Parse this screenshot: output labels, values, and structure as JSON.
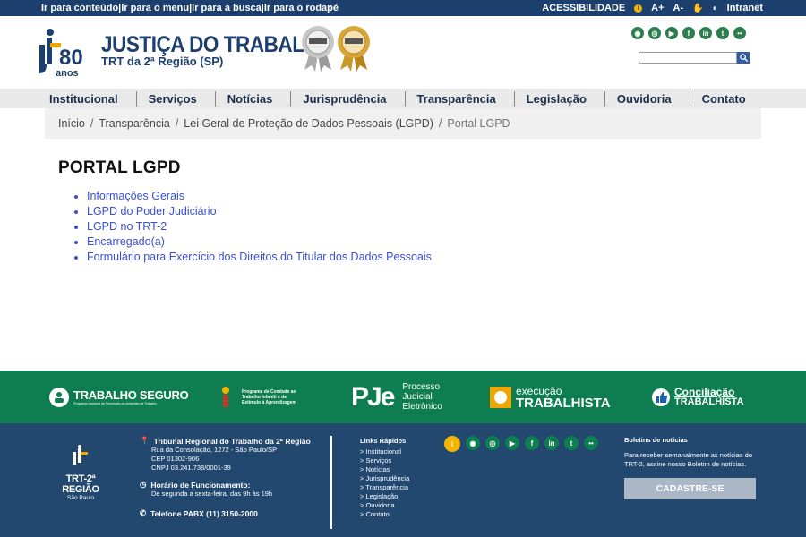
{
  "topbar": {
    "skip_links": [
      "Ir para conteúdo|",
      " Ir para o menu|",
      " Ir para a busca|",
      " Ir para o rodapé"
    ],
    "acessibilidade": "ACESSIBILIDADE",
    "font_up": "A+",
    "font_down": "A-",
    "intranet": "Intranet"
  },
  "header": {
    "logo_number": "80",
    "logo_anos": "anos",
    "brand_title": "JUSTIÇA DO TRABALHO",
    "brand_subtitle": "TRT da 2ª Região (SP)",
    "social_icons": [
      "rss-icon",
      "instagram-icon",
      "youtube-icon",
      "facebook-icon",
      "linkedin-icon",
      "twitter-icon",
      "flickr-icon"
    ],
    "search_placeholder": ""
  },
  "nav": {
    "items": [
      "Institucional",
      "Serviços",
      "Notícias",
      "Jurisprudência",
      "Transparência",
      "Legislação",
      "Ouvidoria",
      "Contato"
    ]
  },
  "breadcrumb": {
    "items": [
      "Início",
      "Transparência",
      "Lei Geral de Proteção de Dados Pessoais (LGPD)"
    ],
    "current": "Portal LGPD"
  },
  "main": {
    "title": "PORTAL LGPD",
    "links": [
      "Informações Gerais",
      "LGPD do Poder Judiciário",
      "LGPD no TRT-2",
      "Encarregado(a)",
      "Formulário para Exercício dos Direitos do Titular dos Dados Pessoais"
    ]
  },
  "band": {
    "trabalho_seguro": "TRABALHO SEGURO",
    "trabalho_seguro_sub": "Programa Nacional de Prevenção de Acidentes de Trabalho",
    "combate": "Programa de Combate ao Trabalho Infantil e de Estímulo à Aprendizagem",
    "pje": "PJe",
    "pje_text": [
      "Processo",
      "Judicial",
      "Eletrônico"
    ],
    "execucao_1": "execução",
    "execucao_2": "TRABALHISTA",
    "conciliacao_1": "Conciliação",
    "conciliacao_2": "TRABALHISTA"
  },
  "footer": {
    "trt_name": "TRT-2ª REGIÃO",
    "trt_city": "São Paulo",
    "org_name": "Tribunal Regional do Trabalho da 2ª Região",
    "address": [
      "Rua da Consolação, 1272 - São Paulo/SP",
      "CEP 01302-906",
      "CNPJ 03.241.738/0001-39"
    ],
    "hours_label": "Horário de Funcionamento:",
    "hours": "De segunda a sexta-feira, das 9h às 19h",
    "phone": "Telefone PABX (11) 3150-2000",
    "quick_title": "Links Rápidos",
    "quick_links": [
      "> Institucional",
      "> Serviços",
      "> Notícias",
      "> Jurisprudência",
      "> Transparência",
      "> Legislação",
      "> Ouvidoria",
      "> Contato"
    ],
    "news_title": "Boletins de notícias",
    "news_text": "Para receber semanalmente as notícias do TRT-2, assine nosso Boletim de notícias.",
    "cadastre": "CADASTRE-SE"
  }
}
